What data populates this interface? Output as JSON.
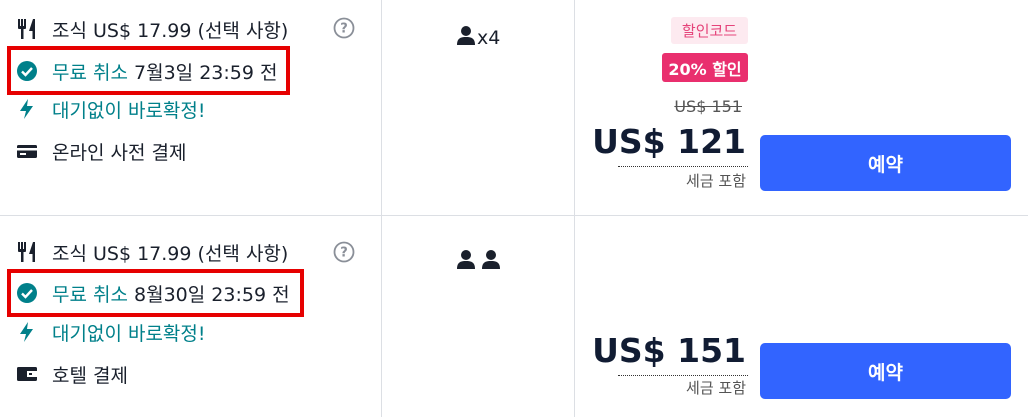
{
  "offers": [
    {
      "breakfast": "조식 US$ 17.99 (선택 사항)",
      "cancel_label": "무료 취소",
      "cancel_deadline": "7월3일 23:59 전",
      "instant_confirm": "대기없이 바로확정!",
      "payment": "온라인 사전 결제",
      "guests_text": "x4",
      "promo_code": "할인코드",
      "promo_discount": "20% 할인",
      "original_price": "US$ 151",
      "price": "US$ 121",
      "tax_note": "세금 포함",
      "book_label": "예약"
    },
    {
      "breakfast": "조식 US$ 17.99 (선택 사항)",
      "cancel_label": "무료 취소",
      "cancel_deadline": "8월30일 23:59 전",
      "instant_confirm": "대기없이 바로확정!",
      "payment": "호텔 결제",
      "price": "US$ 151",
      "tax_note": "세금 포함",
      "book_label": "예약"
    }
  ],
  "colors": {
    "teal": "#00808a",
    "highlight_red": "#e60000",
    "book_blue": "#3264ff",
    "promo_pink": "#e92f6e"
  },
  "icons": [
    "fork-knife-icon",
    "check-circle-icon",
    "lightning-icon",
    "credit-card-icon",
    "wallet-icon",
    "help-icon",
    "person-icon"
  ]
}
